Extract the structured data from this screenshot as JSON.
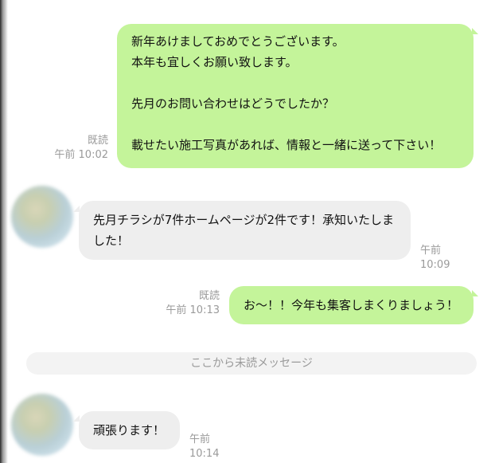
{
  "messages": [
    {
      "direction": "outgoing",
      "text": "新年あけましておめでとうございます。\n本年も宜しくお願い致します。\n\n先月のお問い合わせはどうでしたか？\n\n載せたい施工写真があれば、情報と一緒に送って下さい！",
      "read_label": "既読",
      "time": "午前 10:02"
    },
    {
      "direction": "incoming",
      "text": "先月チラシが7件ホームページが2件です！承知いたしま\nした！",
      "time": "午前 10:09"
    },
    {
      "direction": "outgoing",
      "text": "お～！！今年も集客しまくりましょう！",
      "read_label": "既読",
      "time": "午前 10:13"
    },
    {
      "direction": "incoming",
      "text": "頑張ります！",
      "time": "午前 10:14"
    }
  ],
  "unread_divider": "ここから未読メッセージ",
  "colors": {
    "outgoing_bubble": "#c4f49a",
    "incoming_bubble": "#eeeeee",
    "meta_text": "#9a9a9a"
  }
}
